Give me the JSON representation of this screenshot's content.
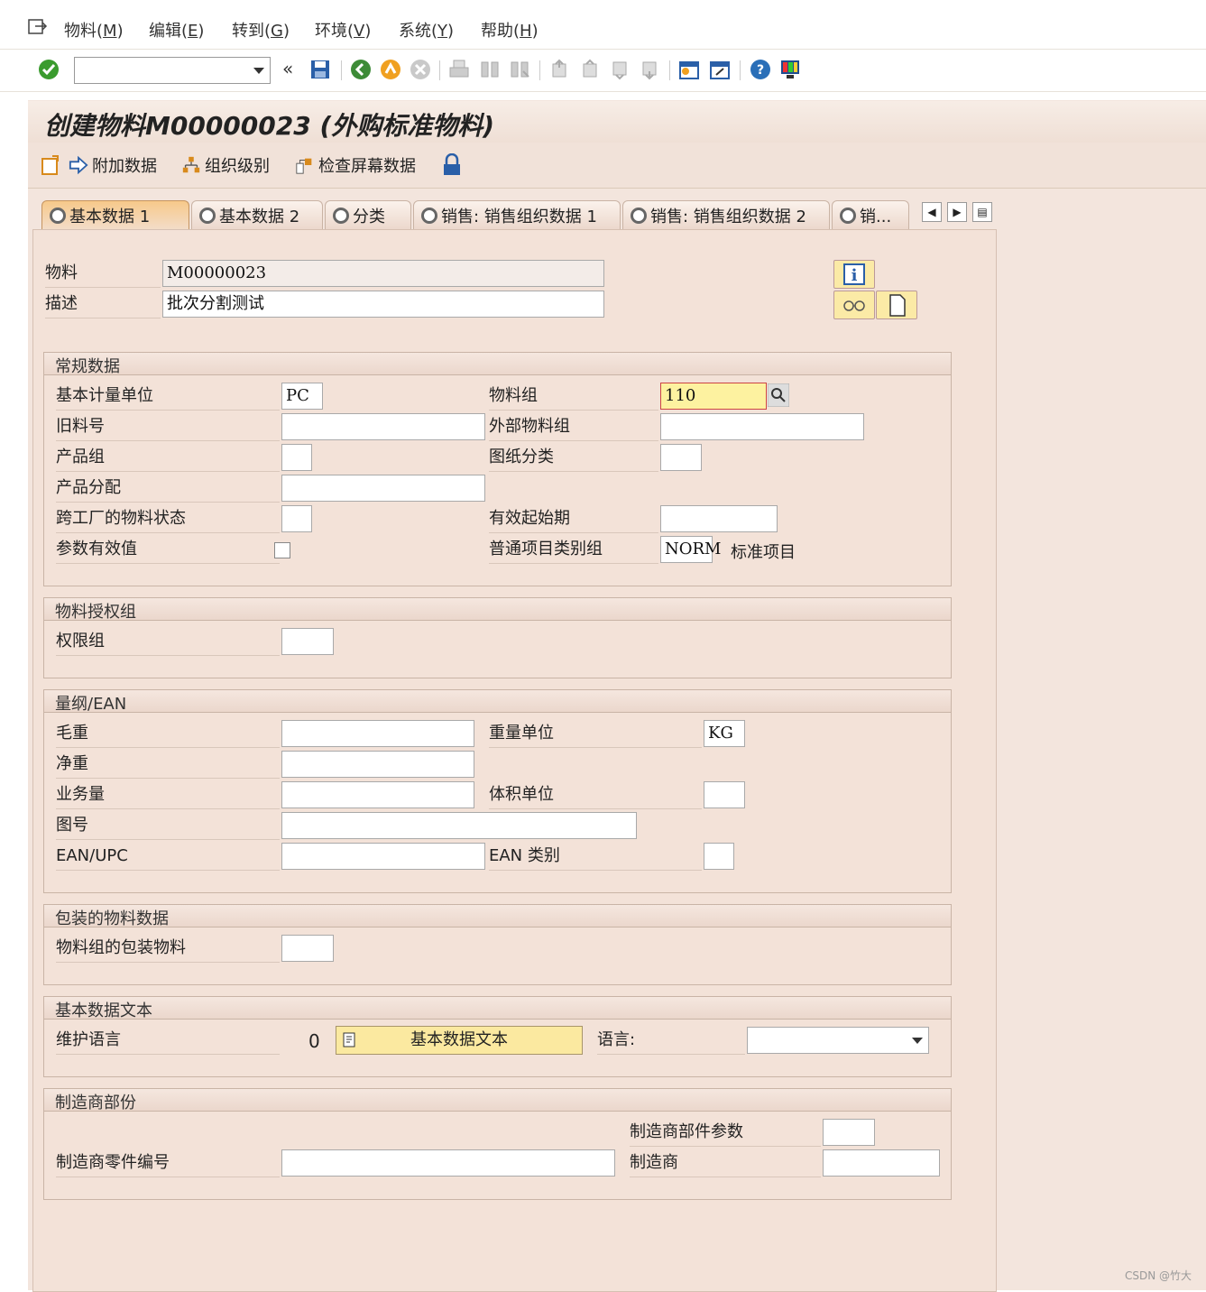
{
  "menu": [
    {
      "label": "物料(",
      "key": "M"
    },
    {
      "label": "编辑(",
      "key": "E"
    },
    {
      "label": "转到(",
      "key": "G"
    },
    {
      "label": "环境(",
      "key": "V"
    },
    {
      "label": "系统(",
      "key": "Y"
    },
    {
      "label": "帮助(",
      "key": "H"
    }
  ],
  "toolbar": {
    "command_value": ""
  },
  "title": "创建物料M00000023 (外购标准物料)",
  "app_toolbar": {
    "additional_data": "附加数据",
    "org_levels": "组织级别",
    "check_screen": "检查屏幕数据"
  },
  "tabs": [
    "基本数据 1",
    "基本数据 2",
    "分类",
    "销售: 销售组织数据 1",
    "销售: 销售组织数据 2",
    "销..."
  ],
  "header": {
    "material_label": "物料",
    "material_value": "M00000023",
    "desc_label": "描述",
    "desc_value": "批次分割测试"
  },
  "general": {
    "title": "常规数据",
    "base_uom_label": "基本计量单位",
    "base_uom": "PC",
    "mat_group_label": "物料组",
    "mat_group": "110",
    "old_mat_label": "旧料号",
    "old_mat": "",
    "ext_group_label": "外部物料组",
    "ext_group": "",
    "division_label": "产品组",
    "division": "",
    "drawing_label": "图纸分类",
    "drawing": "",
    "prod_alloc_label": "产品分配",
    "prod_alloc": "",
    "xplant_status_label": "跨工厂的物料状态",
    "xplant_status": "",
    "valid_from_label": "有效起始期",
    "valid_from": "",
    "param_label": "参数有效值",
    "item_cat_label": "普通项目类别组",
    "item_cat": "NORM",
    "item_cat_text": "标准项目"
  },
  "auth": {
    "title": "物料授权组",
    "auth_group_label": "权限组",
    "auth_group": ""
  },
  "dims": {
    "title": "量纲/EAN",
    "gross_label": "毛重",
    "gross": "",
    "weight_unit_label": "重量单位",
    "weight_unit": "KG",
    "net_label": "净重",
    "net": "",
    "volume_label": "业务量",
    "volume": "",
    "volume_unit_label": "体积单位",
    "volume_unit": "",
    "size_label": "图号",
    "size": "",
    "ean_label": "EAN/UPC",
    "ean": "",
    "ean_cat_label": "EAN 类别",
    "ean_cat": ""
  },
  "packaging": {
    "title": "包装的物料数据",
    "pkg_label": "物料组的包装物料",
    "pkg": ""
  },
  "texts": {
    "title": "基本数据文本",
    "maint_lang_label": "维护语言",
    "maint_lang_count": "0",
    "btn_label": "基本数据文本",
    "lang_label": "语言:",
    "lang_value": ""
  },
  "mfr": {
    "title": "制造商部份",
    "mpn_param_label": "制造商部件参数",
    "mpn_param": "",
    "mpn_label": "制造商零件编号",
    "mpn": "",
    "mfr_label": "制造商",
    "mfr": ""
  },
  "watermark": "CSDN @竹大"
}
